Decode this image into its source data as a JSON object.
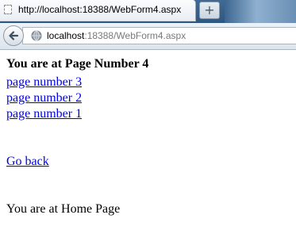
{
  "browser": {
    "tab_title": "http://localhost:18388/WebForm4.aspx",
    "new_tab_label": "+",
    "url_host": "localhost",
    "url_rest": ":18388/WebForm4.aspx"
  },
  "page": {
    "heading": "You are at Page Number 4",
    "links": [
      "page number 3",
      "page number 2",
      "page number 1"
    ],
    "go_back_label": "Go back",
    "footer_text": "You are at Home Page"
  }
}
